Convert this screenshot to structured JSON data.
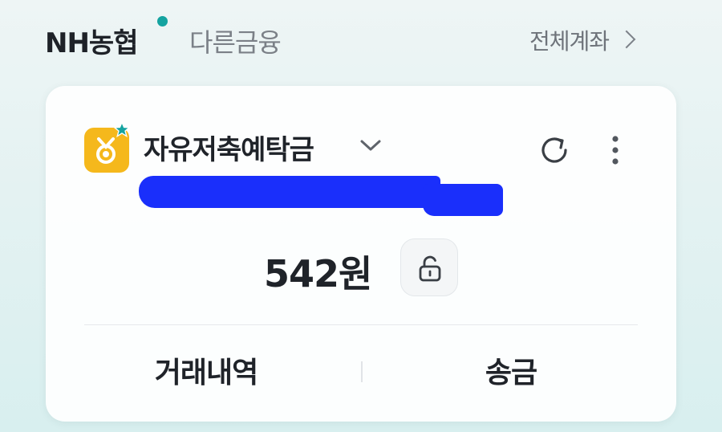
{
  "tabs": {
    "nh": "NH농협",
    "other": "다른금융"
  },
  "header": {
    "all_accounts": "전체계좌"
  },
  "account": {
    "name": "자유저축예탁금",
    "balance": "542원"
  },
  "actions": {
    "history": "거래내역",
    "transfer": "송금"
  },
  "colors": {
    "accent_teal": "#14a3a0",
    "icon_yellow": "#f5b81c",
    "redaction_blue": "#1a2ffb"
  },
  "icons": {
    "account": "medal-icon",
    "star": "star-icon",
    "chevron": "chevron-down-icon",
    "refresh": "refresh-icon",
    "more": "more-vertical-icon",
    "lock": "unlock-icon",
    "arrow": "chevron-right-icon"
  }
}
